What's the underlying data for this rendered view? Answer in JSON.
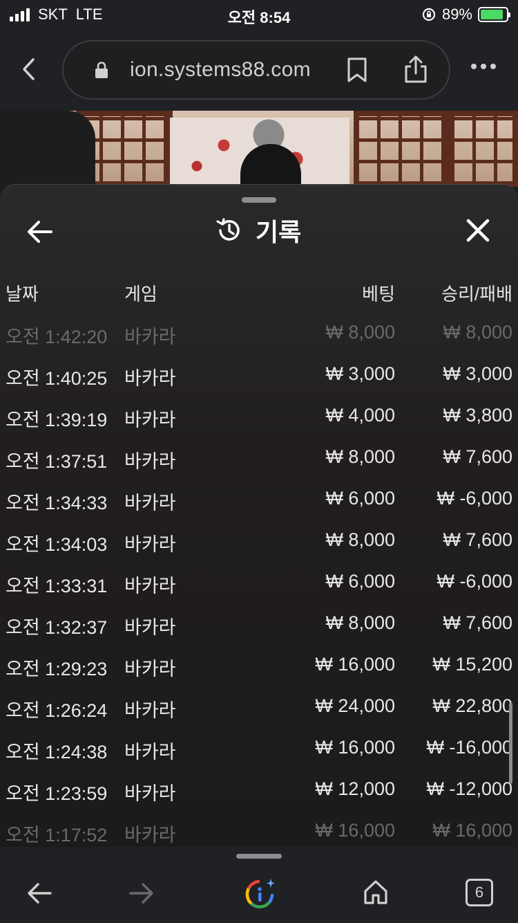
{
  "status_bar": {
    "carrier": "SKT",
    "network": "LTE",
    "time": "오전 8:54",
    "battery_percent": "89%",
    "battery_level": 0.89
  },
  "browser": {
    "url": "ion.systems88.com",
    "icons": [
      "back-chevron-icon",
      "lock-icon",
      "bookmark-icon",
      "share-icon",
      "more-dots-icon"
    ]
  },
  "history_panel": {
    "title": "기록",
    "columns": {
      "date": "날짜",
      "game": "게임",
      "bet": "베팅",
      "result": "승리/패배"
    },
    "rows": [
      {
        "time": "오전 1:42:20",
        "game": "바카라",
        "bet": "₩ 8,000",
        "result": "₩ 8,000",
        "faded": true
      },
      {
        "time": "오전 1:40:25",
        "game": "바카라",
        "bet": "₩ 3,000",
        "result": "₩ 3,000",
        "faded": false
      },
      {
        "time": "오전 1:39:19",
        "game": "바카라",
        "bet": "₩ 4,000",
        "result": "₩ 3,800",
        "faded": false
      },
      {
        "time": "오전 1:37:51",
        "game": "바카라",
        "bet": "₩ 8,000",
        "result": "₩ 7,600",
        "faded": false
      },
      {
        "time": "오전 1:34:33",
        "game": "바카라",
        "bet": "₩ 6,000",
        "result": "₩ -6,000",
        "faded": false
      },
      {
        "time": "오전 1:34:03",
        "game": "바카라",
        "bet": "₩ 8,000",
        "result": "₩ 7,600",
        "faded": false
      },
      {
        "time": "오전 1:33:31",
        "game": "바카라",
        "bet": "₩ 6,000",
        "result": "₩ -6,000",
        "faded": false
      },
      {
        "time": "오전 1:32:37",
        "game": "바카라",
        "bet": "₩ 8,000",
        "result": "₩ 7,600",
        "faded": false
      },
      {
        "time": "오전 1:29:23",
        "game": "바카라",
        "bet": "₩ 16,000",
        "result": "₩ 15,200",
        "faded": false
      },
      {
        "time": "오전 1:26:24",
        "game": "바카라",
        "bet": "₩ 24,000",
        "result": "₩ 22,800",
        "faded": false
      },
      {
        "time": "오전 1:24:38",
        "game": "바카라",
        "bet": "₩ 16,000",
        "result": "₩ -16,000",
        "faded": false
      },
      {
        "time": "오전 1:23:59",
        "game": "바카라",
        "bet": "₩ 12,000",
        "result": "₩ -12,000",
        "faded": false
      },
      {
        "time": "오전 1:17:52",
        "game": "바카라",
        "bet": "₩ 16,000",
        "result": "₩ 16,000",
        "faded": true
      }
    ]
  },
  "toolbar": {
    "tab_count": "6",
    "icons": [
      "back-arrow-icon",
      "forward-arrow-icon",
      "google-lens-icon",
      "home-icon",
      "tabs-icon"
    ]
  }
}
